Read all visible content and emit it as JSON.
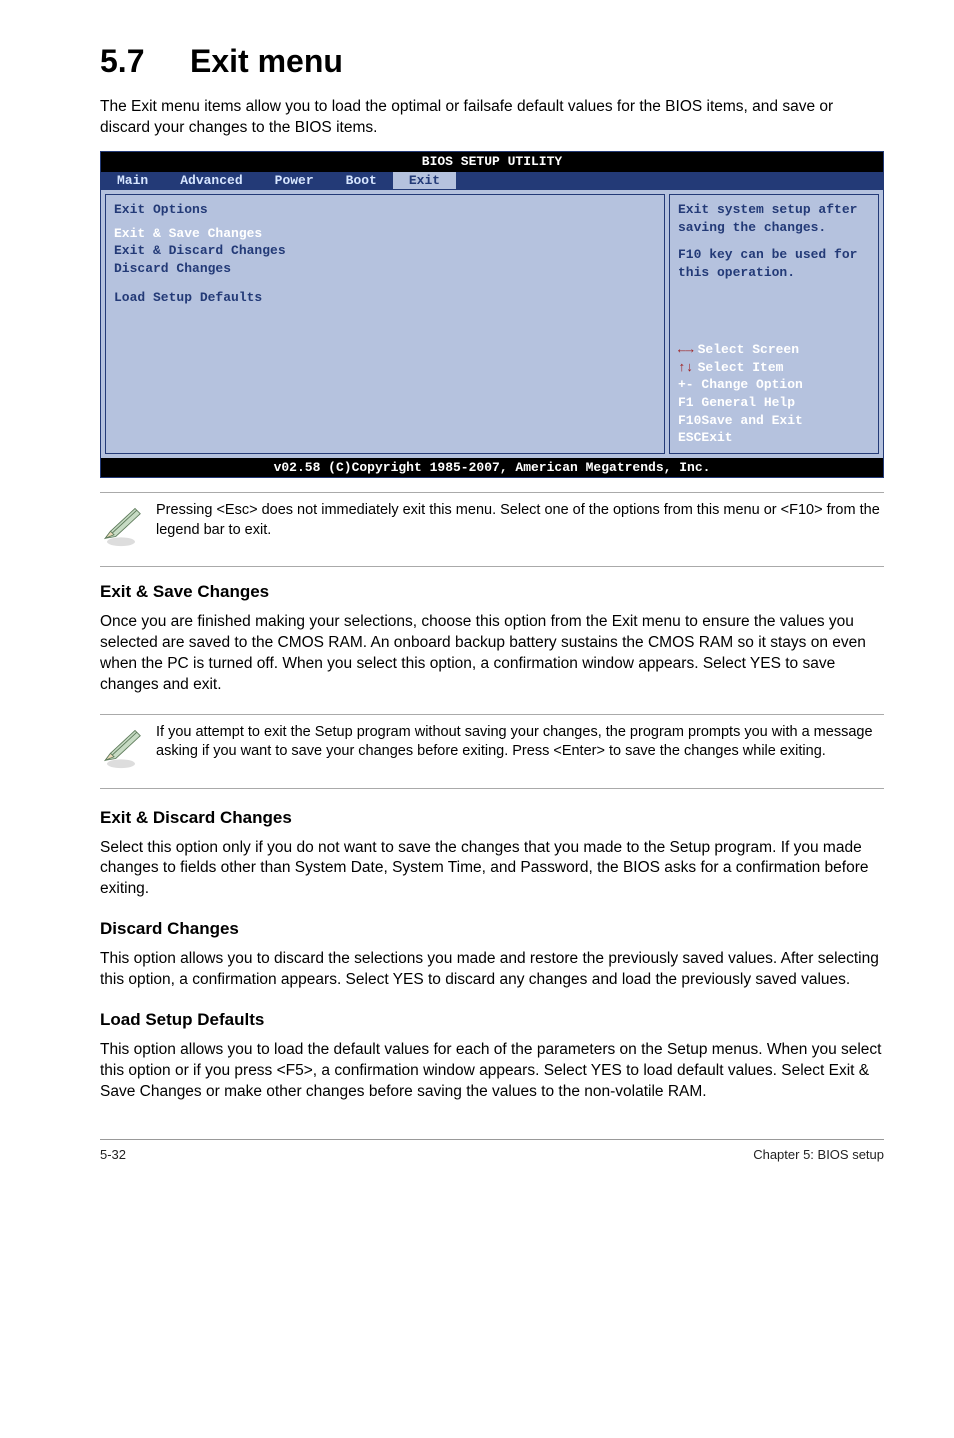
{
  "heading": {
    "num": "5.7",
    "title": "Exit menu"
  },
  "intro": "The Exit menu items allow you to load the optimal or failsafe default values for the BIOS items, and save or discard your changes to the BIOS items.",
  "bios": {
    "title": "BIOS SETUP UTILITY",
    "tabs": [
      "Main",
      "Advanced",
      "Power",
      "Boot",
      "Exit"
    ],
    "active_tab": "Exit",
    "left": {
      "header": "Exit Options",
      "items": [
        "Exit & Save Changes",
        "Exit & Discard Changes",
        "Discard Changes",
        "",
        "Load Setup Defaults"
      ],
      "selected": "Exit & Save Changes"
    },
    "right": {
      "help1": "Exit system setup after saving the changes.",
      "help2": "F10 key can be used for this operation.",
      "nav": {
        "select_screen": "Select Screen",
        "select_item": "Select Item",
        "change_option": "+- Change Option",
        "general_help": "F1 General Help",
        "save_exit": "F10Save and Exit",
        "esc_exit": "ESCExit"
      }
    },
    "footer": "v02.58 (C)Copyright 1985-2007, American Megatrends, Inc."
  },
  "note1": "Pressing <Esc> does not immediately exit this menu. Select one of the options from this menu or <F10> from the legend bar to exit.",
  "s1": {
    "title": "Exit & Save Changes",
    "body": "Once you are finished making your selections, choose this option from the Exit menu to ensure the values you selected are saved to the CMOS RAM. An onboard backup battery sustains the CMOS RAM so it stays on even when the PC is turned off. When you select this option, a confirmation window appears. Select YES to save changes and exit."
  },
  "note2": " If you attempt to exit the Setup program without saving your changes, the program prompts you with a message asking if you want to save your changes before exiting. Press <Enter>  to save the  changes while exiting.",
  "s2": {
    "title": "Exit & Discard Changes",
    "body": "Select this option only if you do not want to save the changes that you  made to the Setup program. If you made changes to fields other than System Date, System Time, and Password, the BIOS asks for a confirmation before exiting."
  },
  "s3": {
    "title": "Discard Changes",
    "body": "This option allows you to discard the selections you made and restore the previously saved values. After selecting this option, a confirmation appears. Select YES to discard any changes and load the previously saved values."
  },
  "s4": {
    "title": "Load Setup Defaults",
    "body": "This option allows you to load the default values for each of the parameters on the Setup menus. When you select this option or if you press <F5>, a confirmation window appears. Select YES to load default values. Select Exit & Save Changes or make other changes before saving the values to the non-volatile RAM."
  },
  "footer": {
    "left": "5-32",
    "right": "Chapter 5: BIOS setup"
  }
}
